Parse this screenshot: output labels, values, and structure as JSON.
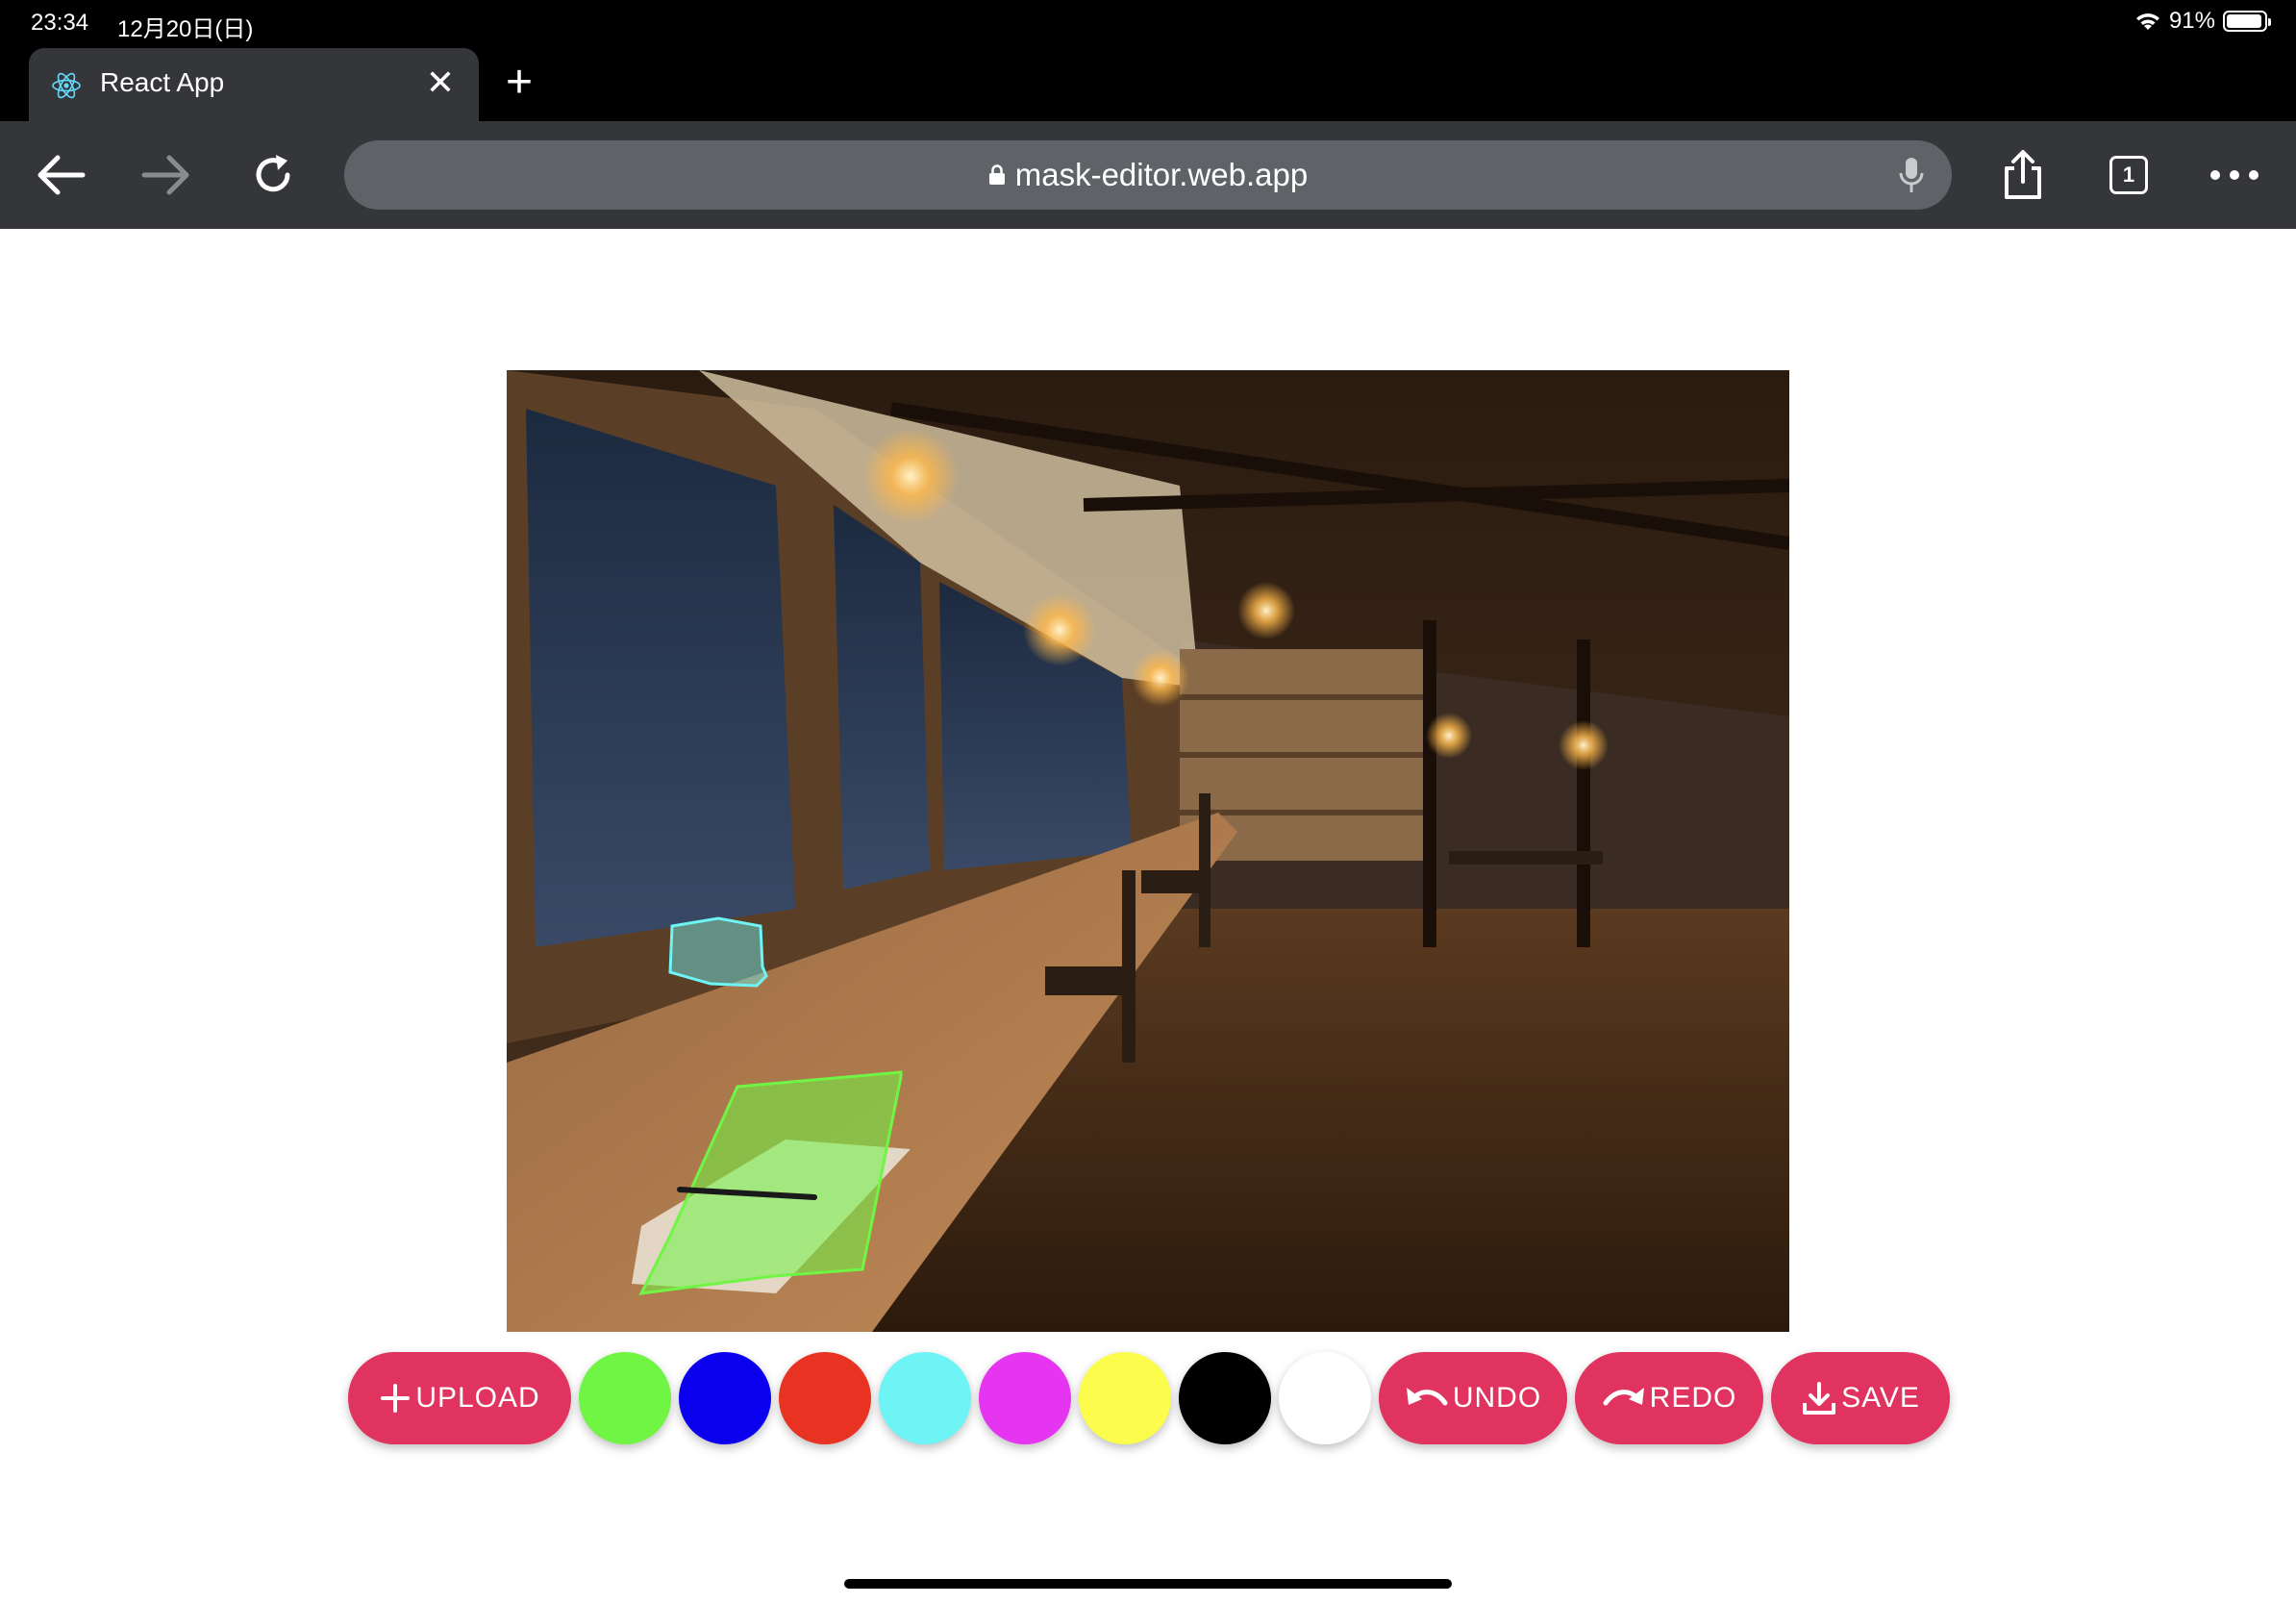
{
  "status_bar": {
    "time": "23:34",
    "date": "12月20日(日)",
    "battery": "91%"
  },
  "tab": {
    "title": "React App",
    "close": "✕"
  },
  "new_tab": "+",
  "address_bar": {
    "url": "mask-editor.web.app"
  },
  "tabs_count": "1",
  "controls": {
    "upload_label": "UPLOAD",
    "undo_label": "UNDO",
    "redo_label": "REDO",
    "save_label": "SAVE",
    "colors": [
      {
        "name": "green",
        "hex": "#70f545"
      },
      {
        "name": "blue",
        "hex": "#0a00ee"
      },
      {
        "name": "red",
        "hex": "#e83222"
      },
      {
        "name": "cyan",
        "hex": "#6ff4f5"
      },
      {
        "name": "magenta",
        "hex": "#e635f0"
      },
      {
        "name": "yellow",
        "hex": "#fcfc4c"
      },
      {
        "name": "black",
        "hex": "#000000"
      },
      {
        "name": "white",
        "hex": "#ffffff"
      }
    ]
  },
  "accent_color": "#e0335f"
}
